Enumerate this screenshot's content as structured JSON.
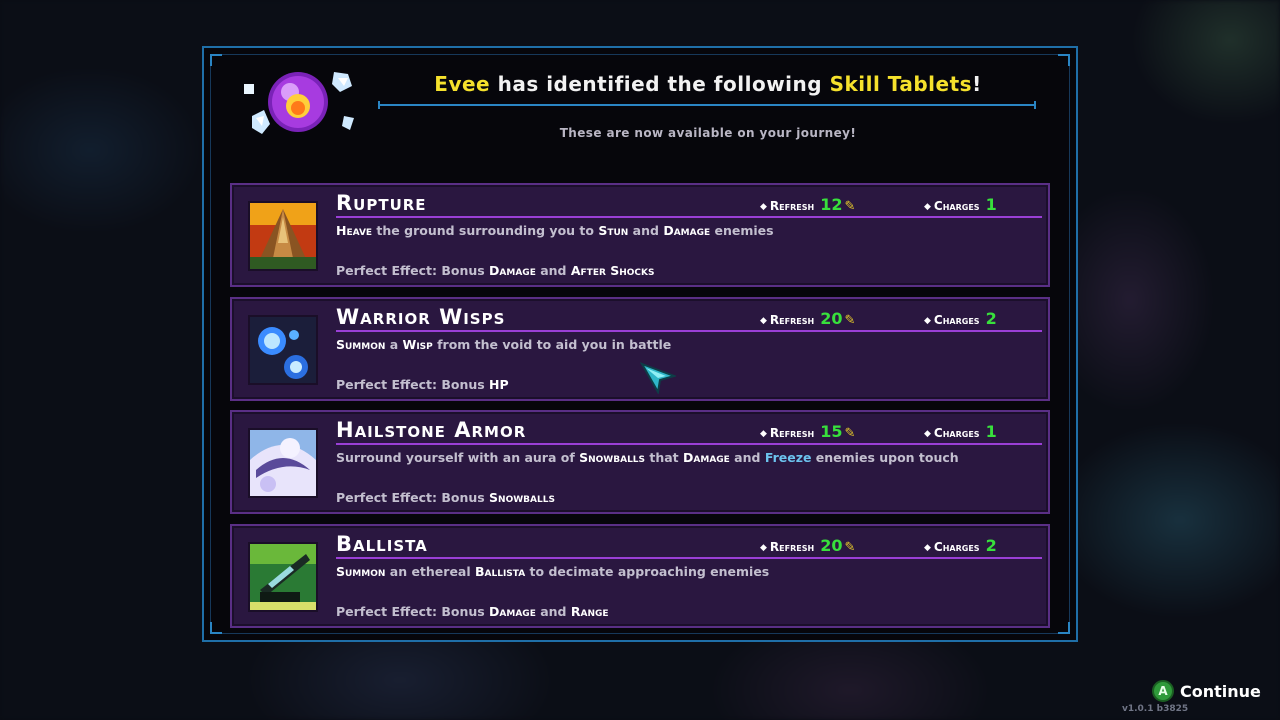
{
  "header": {
    "title_name": "Evee",
    "title_mid": " has identified the following ",
    "title_highlight": "Skill Tablets",
    "title_end": "!",
    "subtitle": "These are now available on your journey!"
  },
  "labels": {
    "refresh": "Refresh",
    "charges": "Charges",
    "perfect_prefix": "Perfect Effect: Bonus "
  },
  "skills": [
    {
      "name": "Rupture",
      "refresh": "12",
      "charges": "1",
      "icon": "rupture-icon",
      "desc_parts": [
        "Heave",
        " the ground surrounding you to ",
        "Stun",
        " and ",
        "Damage",
        " enemies"
      ],
      "perfect_parts": [
        "Damage",
        " and ",
        "After Shocks"
      ]
    },
    {
      "name": "Warrior Wisps",
      "refresh": "20",
      "charges": "2",
      "icon": "warrior-wisps-icon",
      "desc_parts": [
        "Summon",
        " a ",
        "Wisp",
        " from the void to aid you in battle"
      ],
      "perfect_parts": [
        "HP"
      ]
    },
    {
      "name": "Hailstone Armor",
      "refresh": "15",
      "charges": "1",
      "icon": "hailstone-armor-icon",
      "desc_parts": [
        "Surround yourself with an aura of ",
        "Snowballs",
        " that ",
        "Damage",
        " and ",
        "Freeze",
        " enemies upon touch"
      ],
      "perfect_parts": [
        "Snowballs"
      ]
    },
    {
      "name": "Ballista",
      "refresh": "20",
      "charges": "2",
      "icon": "ballista-icon",
      "desc_parts": [
        "Summon",
        " an ethereal ",
        "Ballista",
        " to decimate approaching enemies"
      ],
      "perfect_parts": [
        "Damage",
        " and ",
        "Range"
      ]
    }
  ],
  "footer": {
    "button_glyph": "A",
    "continue_label": "Continue",
    "version": "v1.0.1 b3825"
  },
  "colors": {
    "highlight_yellow": "#f5e12c",
    "stat_green": "#38e03c",
    "freeze_blue": "#6cc3ee",
    "card_bg": "#2a1740",
    "card_border": "#5a2f86",
    "panel_border": "#1f6fa8"
  }
}
